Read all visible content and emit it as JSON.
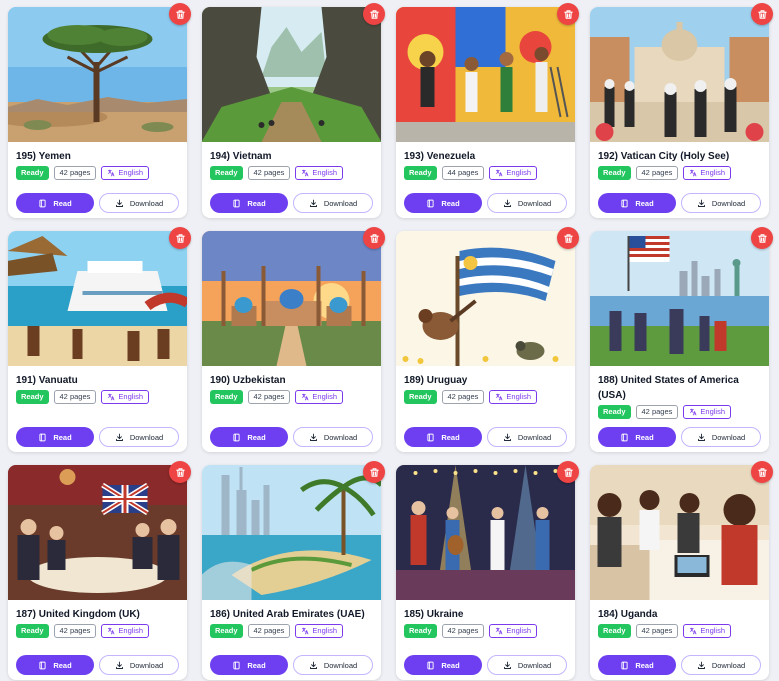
{
  "colors": {
    "ready": "#22c55e",
    "primary": "#6d3ff0",
    "delete": "#ef4444"
  },
  "labels": {
    "ready": "Ready",
    "read": "Read",
    "download": "Download",
    "language": "English"
  },
  "books": [
    {
      "title": "195) Yemen",
      "pages": "42 pages",
      "scene": "yemen-dragon-blood-tree"
    },
    {
      "title": "194) Vietnam",
      "pages": "42 pages",
      "scene": "vietnam-cave-valley"
    },
    {
      "title": "193) Venezuela",
      "pages": "44 pages",
      "scene": "venezuela-mural-painting"
    },
    {
      "title": "192) Vatican City (Holy See)",
      "pages": "42 pages",
      "scene": "vatican-nuns-basilica"
    },
    {
      "title": "191) Vanuatu",
      "pages": "42 pages",
      "scene": "vanuatu-cruise-beach"
    },
    {
      "title": "190) Uzbekistan",
      "pages": "42 pages",
      "scene": "uzbekistan-mosques-sunset"
    },
    {
      "title": "189) Uruguay",
      "pages": "42 pages",
      "scene": "uruguay-flag-bird"
    },
    {
      "title": "188) United States of America (USA)",
      "pages": "42 pages",
      "scene": "usa-statue-of-liberty"
    },
    {
      "title": "187) United Kingdom (UK)",
      "pages": "42 pages",
      "scene": "uk-tea-party"
    },
    {
      "title": "186) United Arab Emirates (UAE)",
      "pages": "42 pages",
      "scene": "uae-palm-island"
    },
    {
      "title": "185) Ukraine",
      "pages": "42 pages",
      "scene": "ukraine-folk-band"
    },
    {
      "title": "184) Uganda",
      "pages": "42 pages",
      "scene": "uganda-classroom"
    }
  ]
}
